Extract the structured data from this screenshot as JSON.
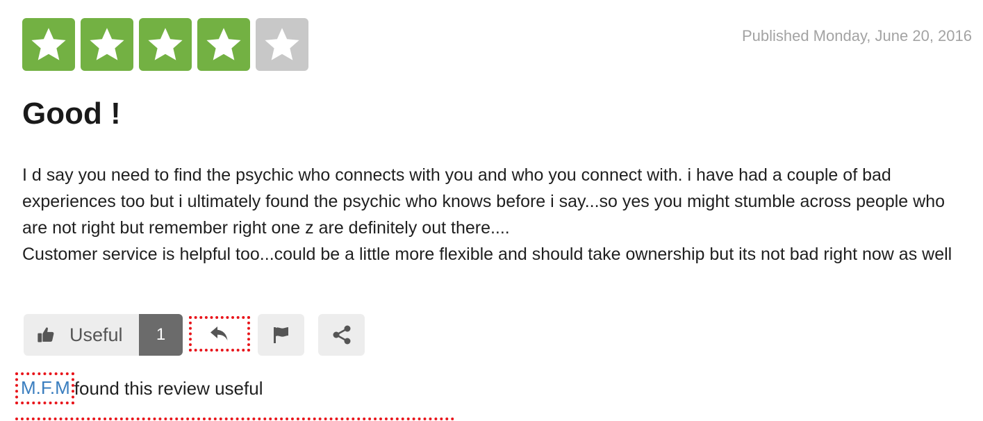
{
  "review": {
    "rating": 4,
    "max_rating": 5,
    "colors": {
      "star_filled": "#73b143",
      "star_empty": "#c8c8c8",
      "link": "#3a7ebf",
      "highlight": "#e8151b"
    },
    "published": "Published Monday, June 20, 2016",
    "title": "Good !",
    "body": [
      "I d say you need to find the psychic who connects with you and who you connect with. i have had a couple of bad experiences too but i ultimately found the psychic who knows before i say...so yes you might stumble across people who are not right but remember right one z are definitely out there....",
      "Customer service is helpful too...could be a little more flexible and should take ownership but its not bad right now as well"
    ]
  },
  "actions": {
    "useful_label": "Useful",
    "useful_count": "1",
    "icons": [
      "thumbs-up-icon",
      "reply-icon",
      "flag-icon",
      "share-icon"
    ]
  },
  "found_useful": {
    "user": "M.F.M",
    "text": "found this review useful"
  }
}
